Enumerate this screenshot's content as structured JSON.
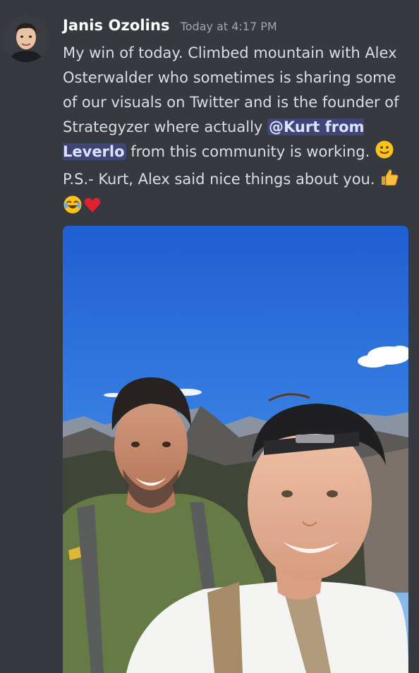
{
  "message": {
    "author": "Janis Ozolins",
    "timestamp": "Today at 4:17 PM",
    "text_1": "My win of today. Climbed mountain with Alex Osterwalder  who sometimes is sharing some of our visuals on Twitter and is the founder of Strategyzer where actually ",
    "mention": "@Kurt from Leverlo",
    "text_2": " from this community is working. ",
    "text_3": " P.S.- Kurt, Alex said nice things about you. ",
    "emojis": [
      "slightly-smiling-face",
      "thumbs-up",
      "joy",
      "red-heart"
    ]
  },
  "attachment": {
    "type": "image",
    "subject": "two-men-mountain-selfie"
  },
  "colors": {
    "background": "#36393f",
    "username": "#ffffff",
    "text": "#dcddde",
    "timestamp": "#a3a6aa",
    "mention_bg": "rgba(88,101,242,0.3)",
    "sky": "#2f6fd6"
  }
}
